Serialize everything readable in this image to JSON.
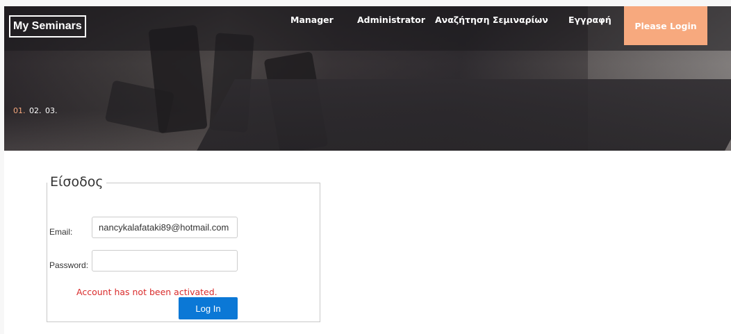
{
  "header": {
    "brand": "My Seminars",
    "nav": [
      {
        "label": "Manager"
      },
      {
        "label": "Administrator"
      },
      {
        "label": "Αναζήτηση Σεμιναρίων"
      },
      {
        "label": "Εγγραφή"
      }
    ],
    "login_button": "Please Login"
  },
  "hero": {
    "slides": [
      "01.",
      "02.",
      "03."
    ],
    "active_slide": "01."
  },
  "login_form": {
    "legend": "Είσοδος",
    "email_label": "Email:",
    "email_value": "nancykalafataki89@hotmail.com",
    "password_label": "Password:",
    "password_value": "",
    "error": "Account has not been activated.",
    "submit": "Log In"
  },
  "colors": {
    "accent": "#f7a97e",
    "primary_button": "#0b78d6",
    "error": "#d92b2b"
  }
}
